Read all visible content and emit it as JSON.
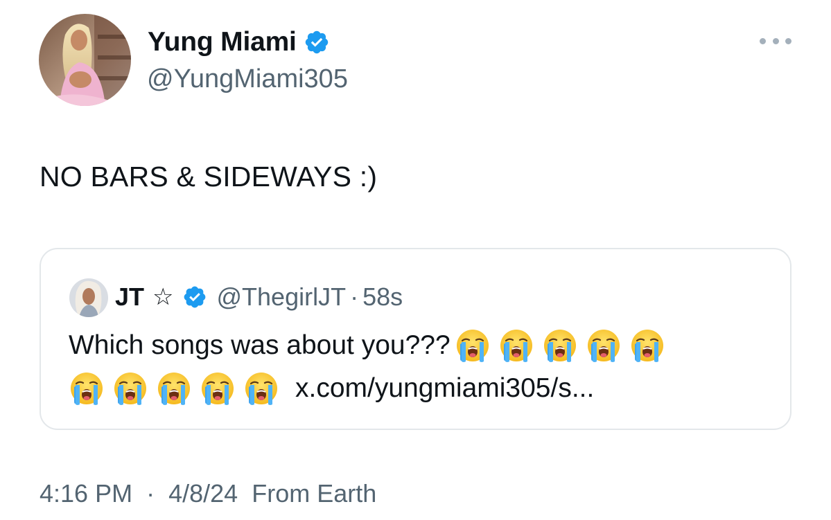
{
  "author": {
    "display_name": "Yung Miami",
    "handle": "@YungMiami305",
    "verified_icon": "verified-badge-icon",
    "avatar_icon": "profile-avatar"
  },
  "more_options_icon": "more-horizontal-icon",
  "tweet": {
    "text": "NO BARS & SIDEWAYS :)"
  },
  "quoted_tweet": {
    "display_name": "JT",
    "name_suffix": "☆",
    "handle": "@ThegirlJT",
    "separator": "·",
    "time": "58s",
    "text": "Which songs was about you???",
    "emoji_icon": "loudly-crying-face-icon",
    "emoji_count_line1": 5,
    "emoji_count_line2": 5,
    "link_text": "x.com/yungmiami305/s..."
  },
  "meta": {
    "time": "4:16 PM",
    "separator": "·",
    "date": "4/8/24",
    "source": "From Earth"
  },
  "colors": {
    "text_primary": "#0f1419",
    "text_secondary": "#536471",
    "verified_blue": "#1d9bf0",
    "border": "#e3e7ea"
  }
}
